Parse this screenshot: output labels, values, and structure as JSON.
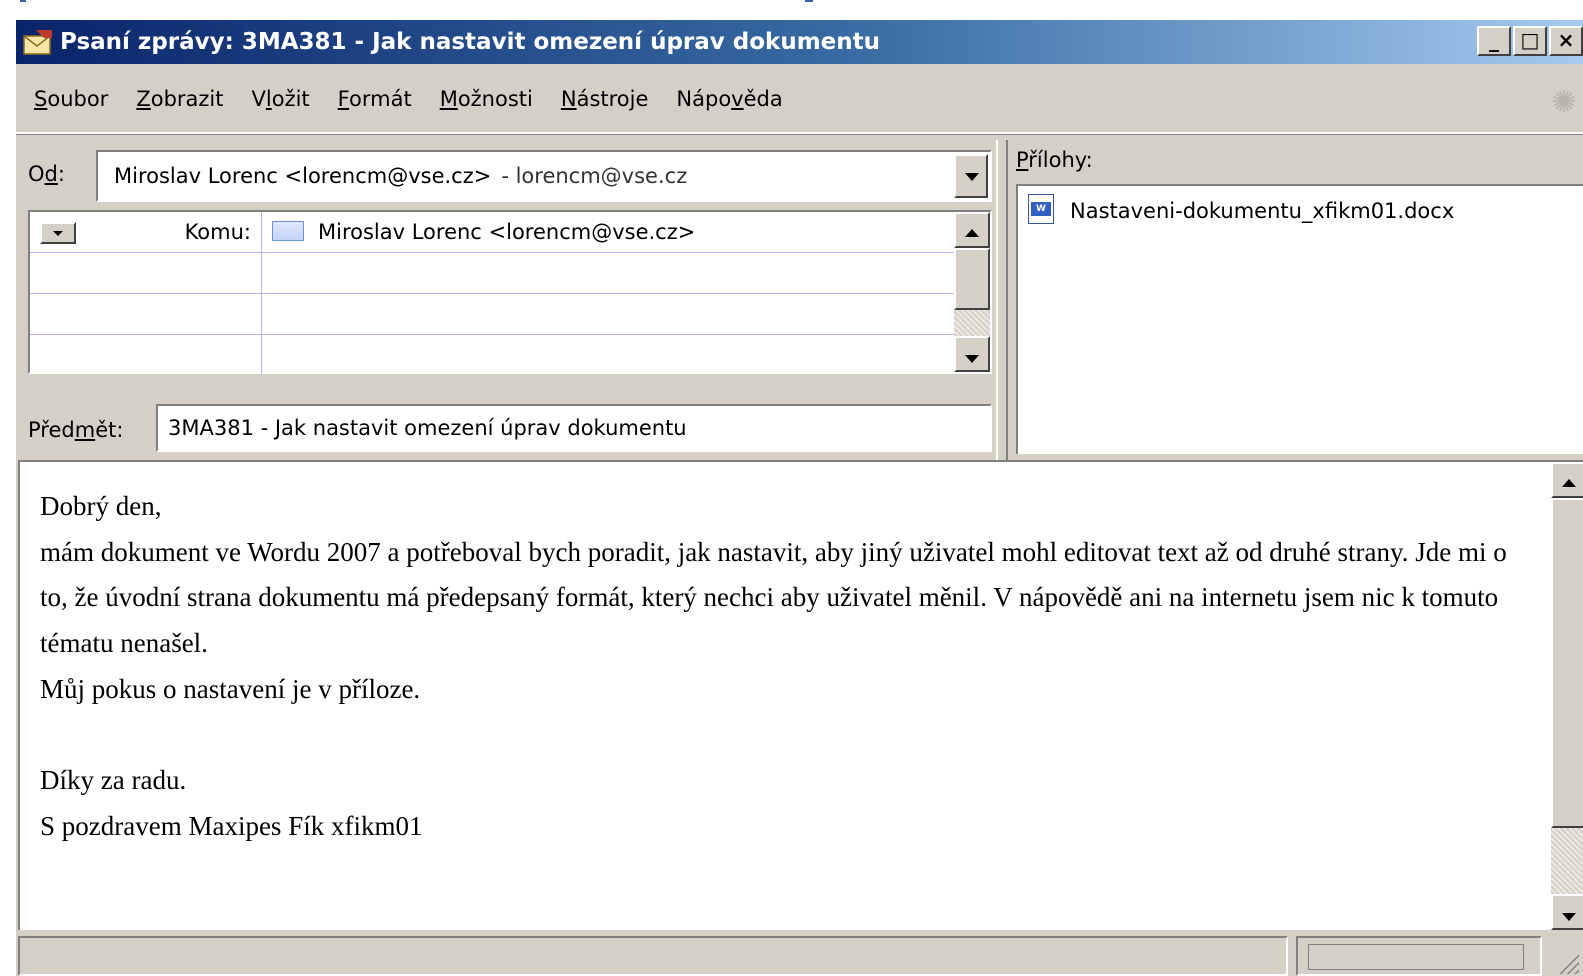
{
  "window": {
    "title": "Psaní zprávy: 3MA381 - Jak nastavit omezení úprav dokumentu",
    "title_icon": "envelope-compose-icon",
    "controls": {
      "minimize": "_",
      "maximize": "□",
      "close": "×"
    }
  },
  "menu": {
    "items": [
      {
        "pre": "",
        "u": "S",
        "post": "oubor"
      },
      {
        "pre": "",
        "u": "Z",
        "post": "obrazit"
      },
      {
        "pre": "V",
        "u": "l",
        "post": "ožit"
      },
      {
        "pre": "",
        "u": "F",
        "post": "ormát"
      },
      {
        "pre": "",
        "u": "M",
        "post": "ožnosti"
      },
      {
        "pre": "",
        "u": "N",
        "post": "ástroje"
      },
      {
        "pre": "Nápo",
        "u": "v",
        "post": "ěda"
      }
    ],
    "throbber_icon": "spinner-icon"
  },
  "header": {
    "from_label": {
      "pre": "O",
      "u": "d",
      "post": ":"
    },
    "from_value": "Miroslav Lorenc <lorencm@vse.cz>",
    "from_account": "- lorencm@vse.cz",
    "recipient_type": "Komu:",
    "recipient_value": "Miroslav Lorenc <lorencm@vse.cz>",
    "subject_label": {
      "pre": "Před",
      "u": "m",
      "post": "ět:"
    },
    "subject_value": "3MA381 - Jak nastavit omezení úprav dokumentu"
  },
  "attachments": {
    "label": {
      "pre": "",
      "u": "P",
      "post": "řílohy:"
    },
    "items": [
      {
        "name": "Nastaveni-dokumentu_xfikm01.docx",
        "icon": "word-document-icon"
      }
    ]
  },
  "body": {
    "text": "Dobrý den,\nmám dokument ve Wordu 2007 a potřeboval bych poradit, jak nastavit, aby jiný uživatel mohl editovat text až od druhé strany. Jde mi o to, že úvodní strana dokumentu má předepsaný formát, který nechci aby uživatel měnil. V nápovědě ani na internetu jsem nic k tomuto tématu nenašel.\nMůj pokus o nastavení je v příloze.\n\nDíky za radu.\nS pozdravem Maxipes Fík xfikm01"
  }
}
